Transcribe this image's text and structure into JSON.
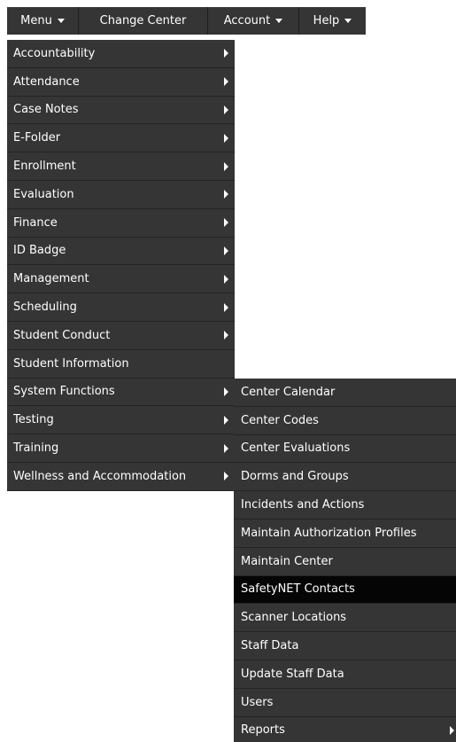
{
  "topbar": {
    "items": [
      {
        "label": "Menu",
        "icon": "caret-down-icon"
      },
      {
        "label": "Change Center"
      },
      {
        "label": "Account",
        "icon": "caret-down-icon"
      },
      {
        "label": "Help",
        "icon": "caret-down-icon"
      }
    ]
  },
  "main_menu": {
    "items": [
      {
        "label": "Accountability",
        "has_submenu": true
      },
      {
        "label": "Attendance",
        "has_submenu": true
      },
      {
        "label": "Case Notes",
        "has_submenu": true
      },
      {
        "label": "E-Folder",
        "has_submenu": true
      },
      {
        "label": "Enrollment",
        "has_submenu": true
      },
      {
        "label": "Evaluation",
        "has_submenu": true
      },
      {
        "label": "Finance",
        "has_submenu": true
      },
      {
        "label": "ID Badge",
        "has_submenu": true
      },
      {
        "label": "Management",
        "has_submenu": true
      },
      {
        "label": "Scheduling",
        "has_submenu": true
      },
      {
        "label": "Student Conduct",
        "has_submenu": true
      },
      {
        "label": "Student Information",
        "has_submenu": false
      },
      {
        "label": "System Functions",
        "has_submenu": true
      },
      {
        "label": "Testing",
        "has_submenu": true
      },
      {
        "label": "Training",
        "has_submenu": true
      },
      {
        "label": "Wellness and Accommodation",
        "has_submenu": true
      }
    ]
  },
  "submenu": {
    "items": [
      {
        "label": "Center Calendar",
        "has_submenu": false
      },
      {
        "label": "Center Codes",
        "has_submenu": false
      },
      {
        "label": "Center Evaluations",
        "has_submenu": false
      },
      {
        "label": "Dorms and Groups",
        "has_submenu": false
      },
      {
        "label": "Incidents and Actions",
        "has_submenu": false
      },
      {
        "label": "Maintain Authorization Profiles",
        "has_submenu": false
      },
      {
        "label": "Maintain Center",
        "has_submenu": false
      },
      {
        "label": "SafetyNET Contacts",
        "has_submenu": false,
        "active": true
      },
      {
        "label": "Scanner Locations",
        "has_submenu": false
      },
      {
        "label": "Staff Data",
        "has_submenu": false
      },
      {
        "label": "Update Staff Data",
        "has_submenu": false
      },
      {
        "label": "Users",
        "has_submenu": false
      },
      {
        "label": "Reports",
        "has_submenu": true
      }
    ]
  },
  "colors": {
    "menu_background": "#353535",
    "active_item_background": "#050505",
    "text": "#ffffff",
    "page_background": "#ffffff"
  }
}
